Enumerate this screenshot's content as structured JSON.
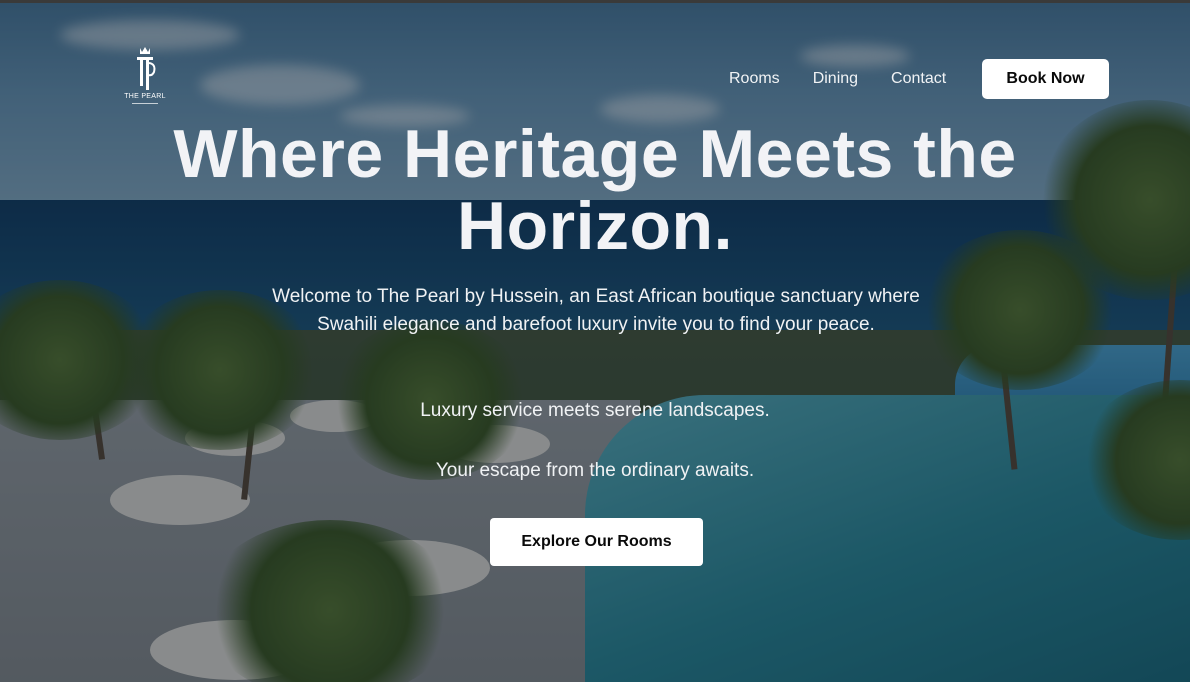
{
  "brand": {
    "logo_text": "THE PEARL"
  },
  "nav": {
    "items": [
      {
        "label": "Rooms"
      },
      {
        "label": "Dining"
      },
      {
        "label": "Contact"
      }
    ],
    "cta_label": "Book Now"
  },
  "hero": {
    "title": "Where Heritage Meets the Horizon.",
    "intro": "Welcome to The Pearl by Hussein, an East African boutique sanctuary where Swahili elegance and barefoot luxury invite you to find your peace.",
    "line2": "Luxury service meets serene landscapes.",
    "line3": "Your escape from the ordinary awaits.",
    "cta_label": "Explore Our Rooms"
  },
  "colors": {
    "button_bg": "#ffffff",
    "button_text": "#0a0a0a",
    "heading_text": "#f2f3f6"
  },
  "icons": {
    "logo": "crown-monogram-icon"
  }
}
